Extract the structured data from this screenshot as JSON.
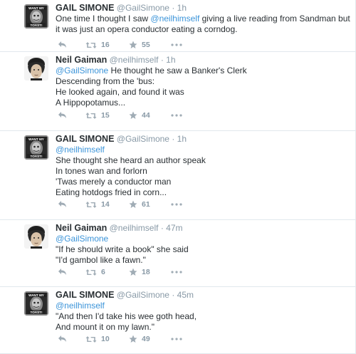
{
  "tweets": [
    {
      "avatar": "gail-avatar",
      "avatar_caption_top": "WANT MY",
      "avatar_caption_bottom": "TOAST!",
      "name": "GAIL SIMONE",
      "handle": "@GailSimone",
      "time": "1h",
      "lines": [
        {
          "pre": "One time I thought I saw ",
          "mention": "@neilhimself",
          "post": " giving a live reading from Sandman but"
        },
        {
          "pre": "it was just an opera conductor eating a corndog.",
          "mention": "",
          "post": ""
        }
      ],
      "retweets": "16",
      "favorites": "55"
    },
    {
      "avatar": "neil-avatar",
      "name": "Neil Gaiman",
      "handle": "@neilhimself",
      "time": "1h",
      "lines": [
        {
          "pre": "",
          "mention": "@GailSimone",
          "post": " He thought he saw a Banker's Clerk"
        },
        {
          "pre": "Descending from the 'bus:",
          "mention": "",
          "post": ""
        },
        {
          "pre": "He looked again, and found it was",
          "mention": "",
          "post": ""
        },
        {
          "pre": "A Hippopotamus...",
          "mention": "",
          "post": ""
        }
      ],
      "retweets": "15",
      "favorites": "44"
    },
    {
      "avatar": "gail-avatar",
      "avatar_caption_top": "WANT MY",
      "avatar_caption_bottom": "TOAST!",
      "name": "GAIL SIMONE",
      "handle": "@GailSimone",
      "time": "1h",
      "lines": [
        {
          "pre": "",
          "mention": "@neilhimself",
          "post": ""
        },
        {
          "pre": "She thought she heard an author speak",
          "mention": "",
          "post": ""
        },
        {
          "pre": "In tones wan and forlorn",
          "mention": "",
          "post": ""
        },
        {
          "pre": "'Twas merely a conductor man",
          "mention": "",
          "post": ""
        },
        {
          "pre": "Eating hotdogs fried in corn...",
          "mention": "",
          "post": ""
        }
      ],
      "retweets": "14",
      "favorites": "61"
    },
    {
      "avatar": "neil-avatar",
      "name": "Neil Gaiman",
      "handle": "@neilhimself",
      "time": "47m",
      "lines": [
        {
          "pre": "",
          "mention": "@GailSimone",
          "post": ""
        },
        {
          "pre": "\"If he should write a book\" she said",
          "mention": "",
          "post": ""
        },
        {
          "pre": "\"I'd gambol like a fawn.\"",
          "mention": "",
          "post": ""
        }
      ],
      "retweets": "6",
      "favorites": "18"
    },
    {
      "avatar": "gail-avatar",
      "avatar_caption_top": "WANT MY",
      "avatar_caption_bottom": "TOAST!",
      "name": "GAIL SIMONE",
      "handle": "@GailSimone",
      "time": "45m",
      "lines": [
        {
          "pre": "",
          "mention": "@neilhimself",
          "post": ""
        },
        {
          "pre": "\"And then I'd take his wee goth head,",
          "mention": "",
          "post": ""
        },
        {
          "pre": "And mount it on my lawn.\"",
          "mention": "",
          "post": ""
        }
      ],
      "retweets": "10",
      "favorites": "49"
    }
  ],
  "meta_separator": "·",
  "icons": {
    "reply": "reply-icon",
    "retweet": "retweet-icon",
    "favorite": "star-icon",
    "more": "more-dots-icon"
  },
  "colors": {
    "mention": "#3b94d9",
    "meta": "#8899a6",
    "border": "#e1e8ed"
  }
}
